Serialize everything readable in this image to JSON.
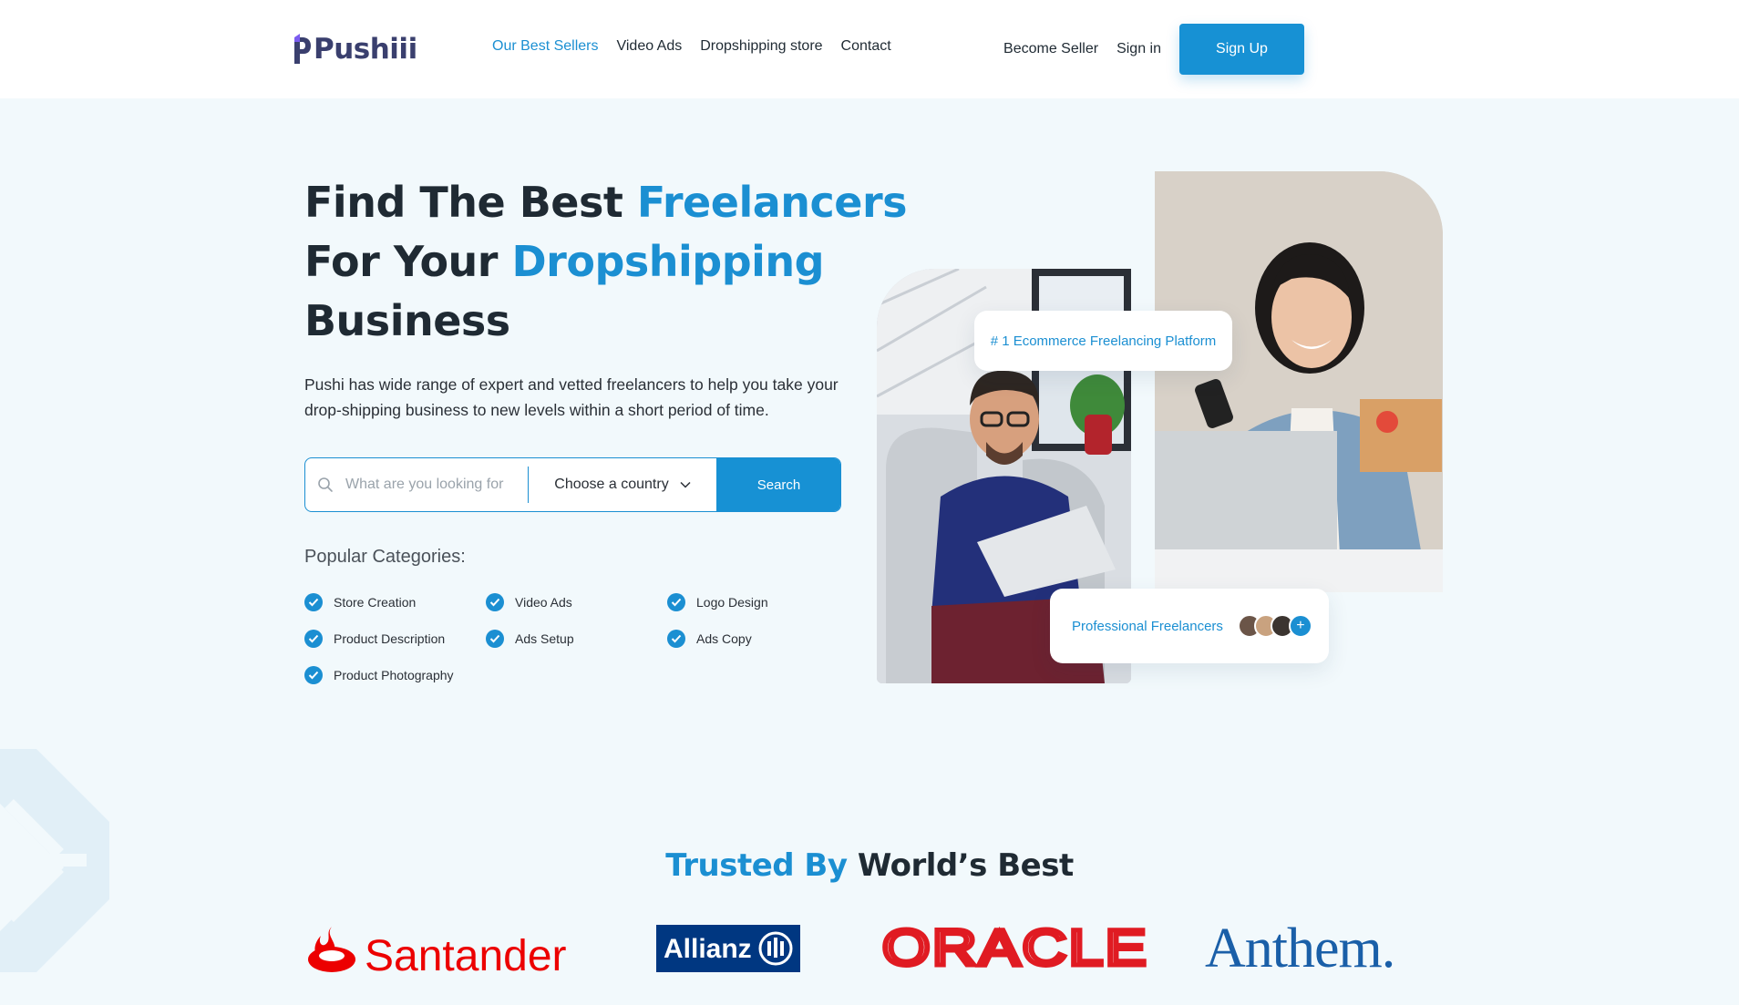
{
  "brand": {
    "name": "Pushiii",
    "colors": {
      "primary": "#1b8fd2",
      "dark": "#1f2a33",
      "logo": "#3a3f6e",
      "logo_accent": "#7b5cf0"
    }
  },
  "nav": {
    "items": [
      {
        "label": "Our Best Sellers",
        "active": true
      },
      {
        "label": "Video Ads",
        "active": false
      },
      {
        "label": "Dropshipping store",
        "active": false
      },
      {
        "label": "Contact",
        "active": false
      }
    ],
    "become_seller": "Become Seller",
    "sign_in": "Sign in",
    "sign_up": "Sign Up"
  },
  "hero": {
    "title_line1_a": "Find The Best ",
    "title_line1_b": "Freelancers",
    "title_line2_a": "For Your ",
    "title_line2_b": "Dropshipping",
    "title_line3": "Business",
    "description": "Pushi has wide range of expert and vetted freelancers to help you take your drop-shipping business to new levels within a short period of time."
  },
  "search": {
    "icon": "search-icon",
    "placeholder": "What are you looking for",
    "country_label": "Choose a country",
    "button": "Search"
  },
  "popular": {
    "title": "Popular Categories:",
    "categories": [
      "Store Creation",
      "Video Ads",
      "Logo Design",
      "Product Description",
      "Ads Setup",
      "Ads Copy",
      "Product Photography"
    ]
  },
  "badges": {
    "top": "# 1 Ecommerce Freelancing Platform",
    "bottom": "Professional Freelancers",
    "plus": "+"
  },
  "trusted": {
    "title_a": "Trusted By",
    "title_b": " World’s Best",
    "logos": [
      "Santander",
      "Allianz",
      "ORACLE",
      "Anthem."
    ]
  }
}
